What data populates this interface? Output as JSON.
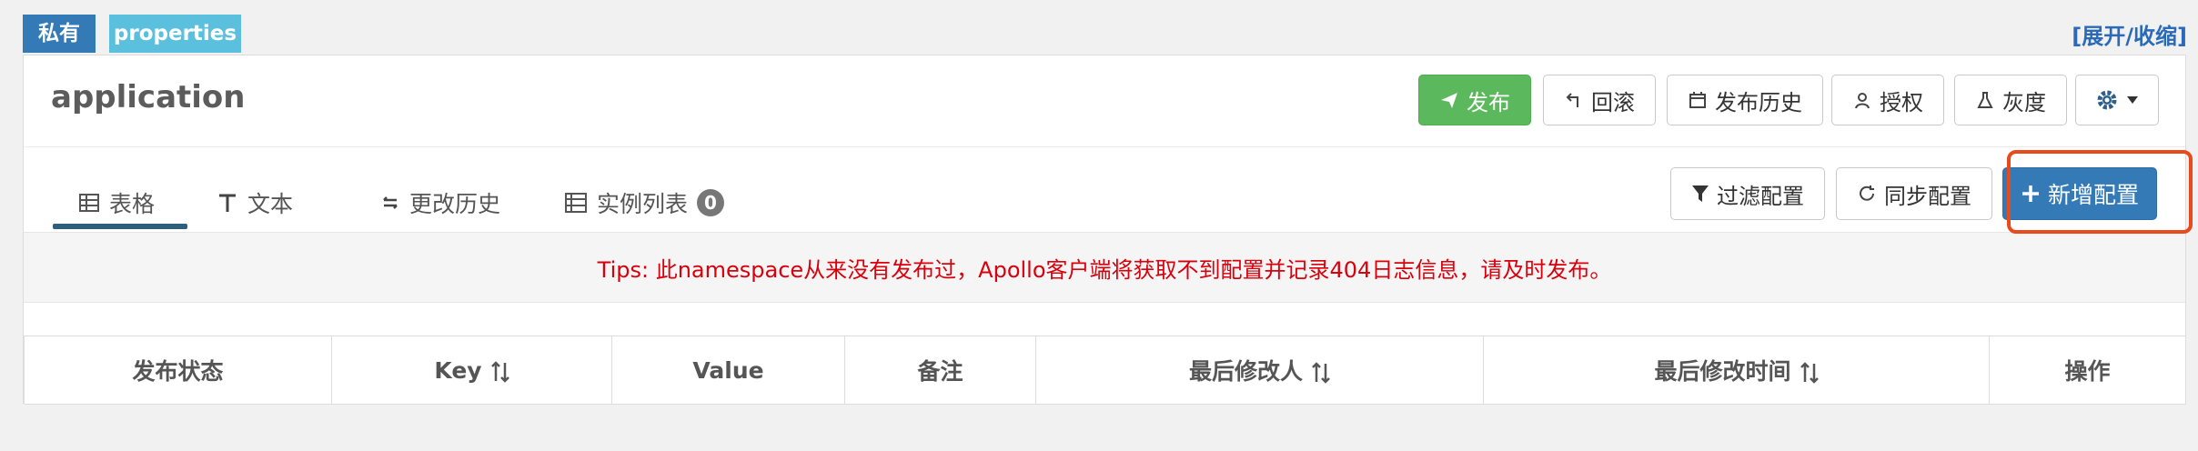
{
  "badges": {
    "private": "私有",
    "format": "properties"
  },
  "expand_link": "[展开/收缩]",
  "namespace": {
    "name": "application"
  },
  "actions": {
    "publish": "发布",
    "rollback": "回滚",
    "history": "发布历史",
    "authorize": "授权",
    "gray": "灰度"
  },
  "tabs": [
    {
      "label": "表格",
      "icon": "table-icon"
    },
    {
      "label": "文本",
      "icon": "text-icon"
    },
    {
      "label": "更改历史",
      "icon": "history-icon"
    },
    {
      "label": "实例列表",
      "icon": "instance-list-icon",
      "count": "0"
    }
  ],
  "config_toolbar": {
    "filter": "过滤配置",
    "sync": "同步配置",
    "add": "新增配置"
  },
  "tips": "Tips: 此namespace从来没有发布过，Apollo客户端将获取不到配置并记录404日志信息，请及时发布。",
  "table": {
    "columns": [
      "发布状态",
      "Key",
      "Value",
      "备注",
      "最后修改人",
      "最后修改时间",
      "操作"
    ]
  },
  "colors": {
    "primary": "#337ab7",
    "success": "#5cb85c",
    "info": "#5bc0de",
    "danger": "#d8000c",
    "highlight": "#e84a1b"
  }
}
